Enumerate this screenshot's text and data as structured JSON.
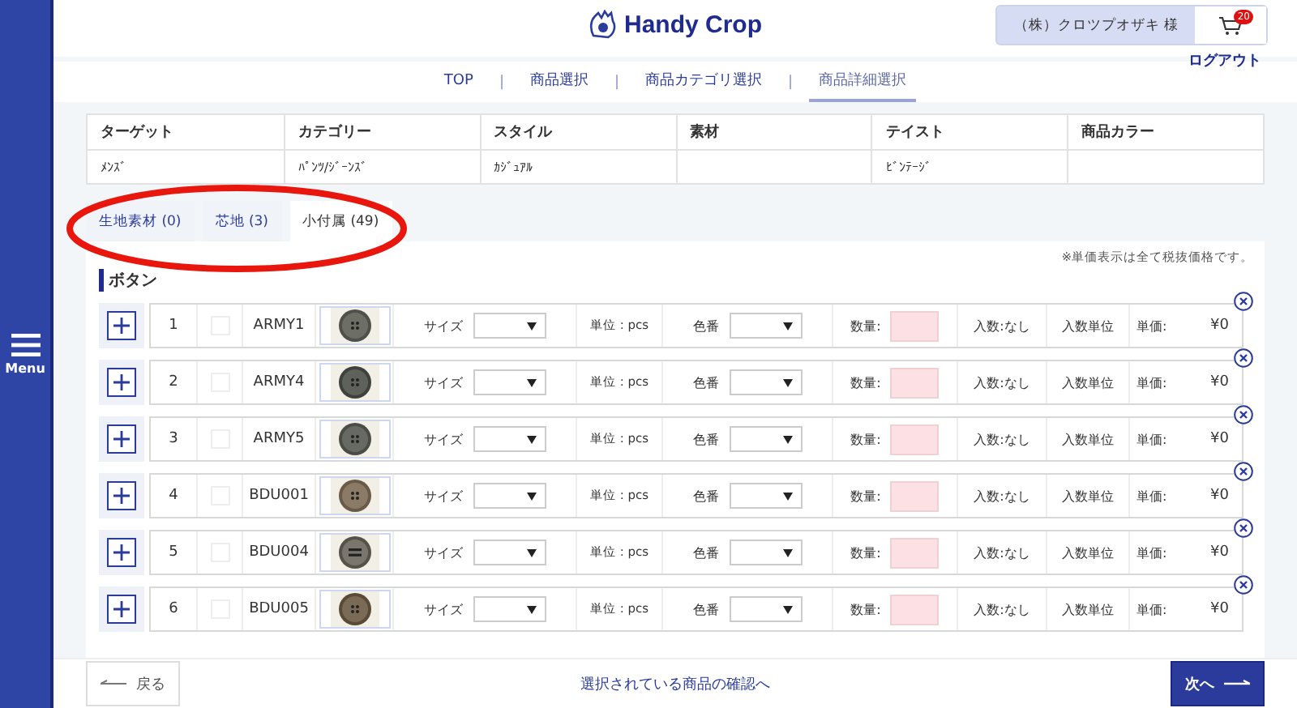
{
  "sidebar": {
    "menu_label": "Menu"
  },
  "header": {
    "logo_text": "Handy Crop",
    "user_name": "（株）クロツプオザキ 様",
    "cart_count": "20",
    "logout": "ログアウト"
  },
  "breadcrumb": [
    {
      "label": "TOP",
      "selected": false
    },
    {
      "separator": "|",
      "label": "商品選択",
      "selected": false
    },
    {
      "separator": "|",
      "label": "商品カテゴリ選択",
      "selected": false
    },
    {
      "separator": "|",
      "label": "商品詳細選択",
      "selected": true
    }
  ],
  "attributes": [
    {
      "column": "ターゲット",
      "value": "ﾒﾝｽﾞ"
    },
    {
      "column": "カテゴリー",
      "value": "ﾊﾟﾝﾂ/ｼﾞｰﾝｽﾞ"
    },
    {
      "column": "スタイル",
      "value": "ｶｼﾞｭｱﾙ"
    },
    {
      "column": "素材"
    },
    {
      "column": "テイスト",
      "value": "ﾋﾞﾝﾃｰｼﾞ"
    },
    {
      "column": "商品カラー"
    }
  ],
  "tabs": [
    {
      "label": "生地素材 (0)",
      "selected": false
    },
    {
      "label": "芯地 (3)",
      "selected": false
    },
    {
      "label": "小付属 (49)",
      "selected": true
    }
  ],
  "tax_note": "※単価表示は全て税抜価格です。",
  "section_title": "ボタン",
  "rows": [
    {
      "no": "1",
      "checked": false,
      "code": "ARMY1",
      "size_label": "サイズ",
      "unit": "単位 : pcs",
      "color_label": "色番",
      "qty_label": "数量:",
      "pack": "入数:なし",
      "pack_unit": "入数単位",
      "price_label": "単価:",
      "price": "¥0"
    },
    {
      "no": "2",
      "checked": false,
      "code": "ARMY4",
      "size_label": "サイズ",
      "unit": "単位 : pcs",
      "color_label": "色番",
      "qty_label": "数量:",
      "pack": "入数:なし",
      "pack_unit": "入数単位",
      "price_label": "単価:",
      "price": "¥0"
    },
    {
      "no": "3",
      "checked": false,
      "code": "ARMY5",
      "size_label": "サイズ",
      "unit": "単位 : pcs",
      "color_label": "色番",
      "qty_label": "数量:",
      "pack": "入数:なし",
      "pack_unit": "入数単位",
      "price_label": "単価:",
      "price": "¥0"
    },
    {
      "no": "4",
      "checked": false,
      "code": "BDU001",
      "size_label": "サイズ",
      "unit": "単位 : pcs",
      "color_label": "色番",
      "qty_label": "数量:",
      "pack": "入数:なし",
      "pack_unit": "入数単位",
      "price_label": "単価:",
      "price": "¥0"
    },
    {
      "no": "5",
      "checked": false,
      "code": "BDU004",
      "size_label": "サイズ",
      "unit": "単位 : pcs",
      "color_label": "色番",
      "qty_label": "数量:",
      "pack": "入数:なし",
      "pack_unit": "入数単位",
      "price_label": "単価:",
      "price": "¥0"
    },
    {
      "no": "6",
      "checked": false,
      "code": "BDU005",
      "size_label": "サイズ",
      "unit": "単位 : pcs",
      "color_label": "色番",
      "qty_label": "数量:",
      "pack": "入数:なし",
      "pack_unit": "入数単位",
      "price_label": "単価:",
      "price": "¥0"
    }
  ],
  "footer": {
    "back": "戻る",
    "confirm_link": "選択されている商品の確認へ",
    "next": "次へ"
  }
}
